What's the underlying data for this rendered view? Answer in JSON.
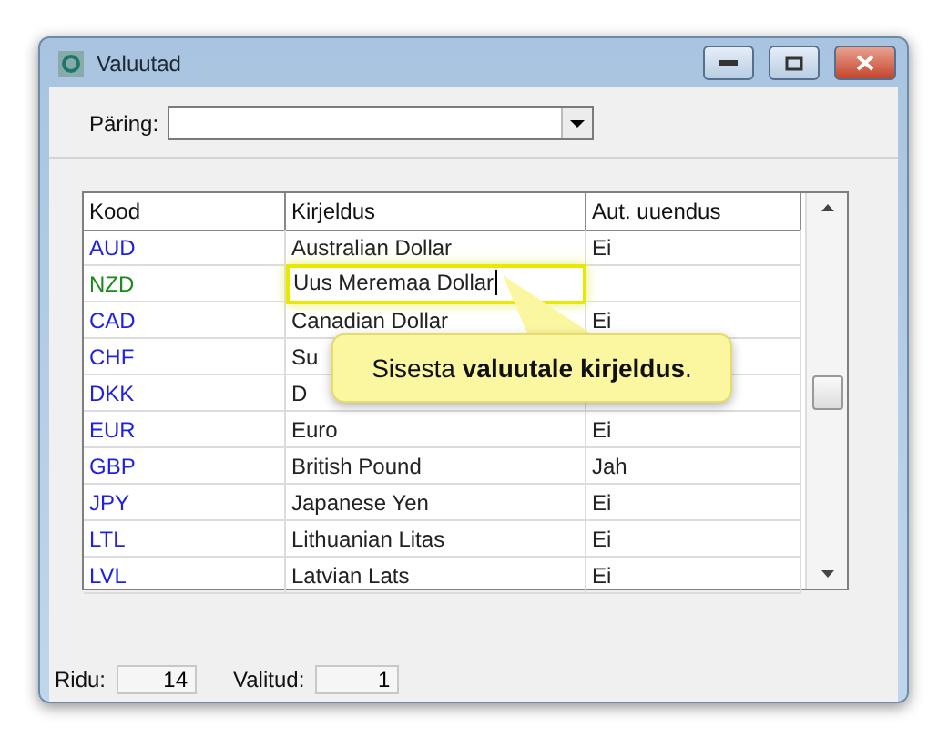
{
  "window": {
    "title": "Valuutad"
  },
  "query": {
    "label": "Päring:"
  },
  "table": {
    "columns": [
      "Kood",
      "Kirjeldus",
      "Aut. uuendus"
    ],
    "rows": [
      {
        "code": "AUD",
        "description": "Australian Dollar",
        "auto": "Ei",
        "color": "#1f1fe6",
        "editing": false
      },
      {
        "code": "NZD",
        "description": "Uus Meremaa Dollar",
        "color": "#1a8a1a",
        "editing": true
      },
      {
        "code": "CAD",
        "description": "Canadian Dollar",
        "auto": "Ei",
        "color": "#1f1fe6",
        "editing": false
      },
      {
        "code": "CHF",
        "description": "Su",
        "color": "#1f1fe6",
        "editing": false
      },
      {
        "code": "DKK",
        "description": "D",
        "color": "#1f1fe6",
        "editing": false
      },
      {
        "code": "EUR",
        "description": "Euro",
        "auto": "Ei",
        "color": "#1f1fe6",
        "editing": false
      },
      {
        "code": "GBP",
        "description": "British Pound",
        "auto": "Jah",
        "color": "#1f1fe6",
        "editing": false
      },
      {
        "code": "JPY",
        "description": "Japanese Yen",
        "auto": "Ei",
        "color": "#1f1fe6",
        "editing": false
      },
      {
        "code": "LTL",
        "description": "Lithuanian Litas",
        "auto": "Ei",
        "color": "#1f1fe6",
        "editing": false
      },
      {
        "code": "LVL",
        "description": "Latvian Lats",
        "auto": "Ei",
        "color": "#1f1fe6",
        "editing": false
      }
    ]
  },
  "callout": {
    "text": "Sisesta **valuutale kirjeldus**."
  },
  "status_bar": {
    "rows_label": "Ridu:",
    "rows_value": "14",
    "selected_label": "Valitud:",
    "selected_value": "1"
  }
}
